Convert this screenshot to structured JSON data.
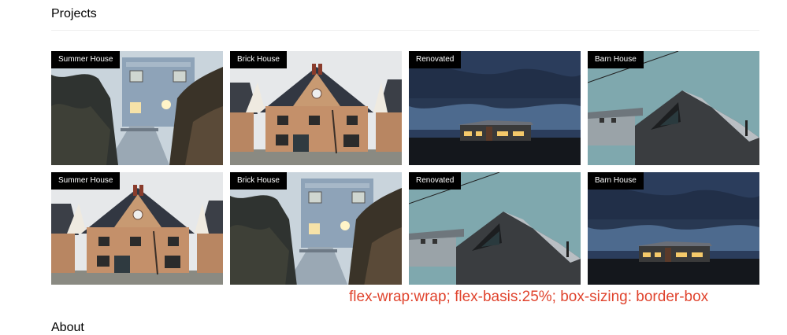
{
  "header": {
    "title": "Projects"
  },
  "gallery": {
    "cards": [
      {
        "label": "Summer House",
        "scene": "summer"
      },
      {
        "label": "Brick House",
        "scene": "brick"
      },
      {
        "label": "Renovated",
        "scene": "night"
      },
      {
        "label": "Barn House",
        "scene": "barn"
      },
      {
        "label": "Summer House",
        "scene": "brick"
      },
      {
        "label": "Brick House",
        "scene": "summer"
      },
      {
        "label": "Renovated",
        "scene": "barn"
      },
      {
        "label": "Barn House",
        "scene": "night"
      }
    ]
  },
  "annotation": {
    "text": "flex-wrap:wrap; flex-basis:25%; box-sizing: border-box"
  },
  "next_section": {
    "title": "About"
  },
  "colors": {
    "badge_bg": "#000000",
    "annotation": "#e0442e"
  }
}
